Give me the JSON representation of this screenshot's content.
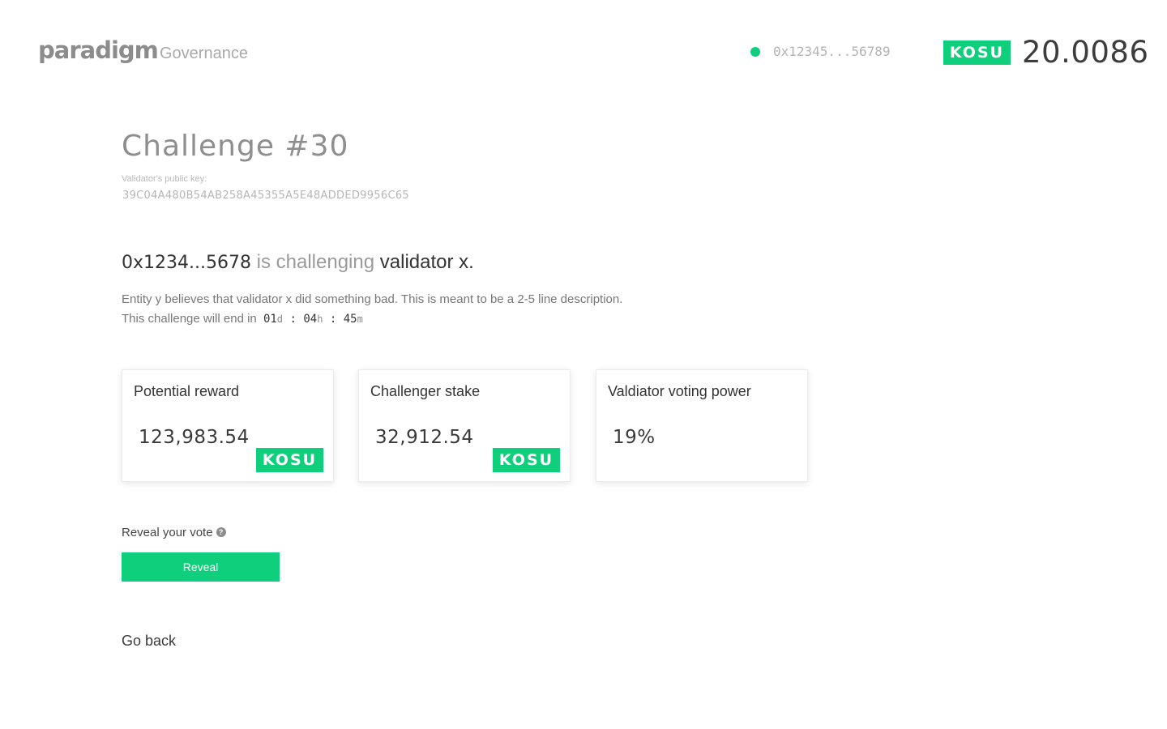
{
  "header": {
    "logo_text": "paradigm",
    "logo_sub": "Governance",
    "status_color": "#0fce7c",
    "wallet_address": "0x12345...56789",
    "token_badge": "KOSU",
    "balance": "20.0086"
  },
  "challenge": {
    "title": "Challenge #30",
    "public_key_label": "Validator's public key:",
    "public_key": "39C04A480B54AB258A45355A5E48ADDED9956C65",
    "challenger": "0x1234...5678",
    "action_text": "is challenging",
    "target": "validator x.",
    "description": "Entity y believes that validator x did something bad. This is meant to be a 2-5 line description.",
    "end_prefix": "This challenge will end in",
    "countdown": {
      "days": "01",
      "days_unit": "d",
      "hours": "04",
      "hours_unit": "h",
      "minutes": "45",
      "minutes_unit": "m"
    }
  },
  "cards": [
    {
      "label": "Potential reward",
      "value": "123,983.54",
      "badge": "KOSU"
    },
    {
      "label": "Challenger stake",
      "value": "32,912.54",
      "badge": "KOSU"
    },
    {
      "label": "Valdiator voting power",
      "value": "19%"
    }
  ],
  "reveal": {
    "label": "Reveal your vote",
    "help_icon": "question-circle-icon",
    "button_label": "Reveal"
  },
  "nav": {
    "go_back": "Go back"
  },
  "colors": {
    "accent": "#0fce7c"
  }
}
